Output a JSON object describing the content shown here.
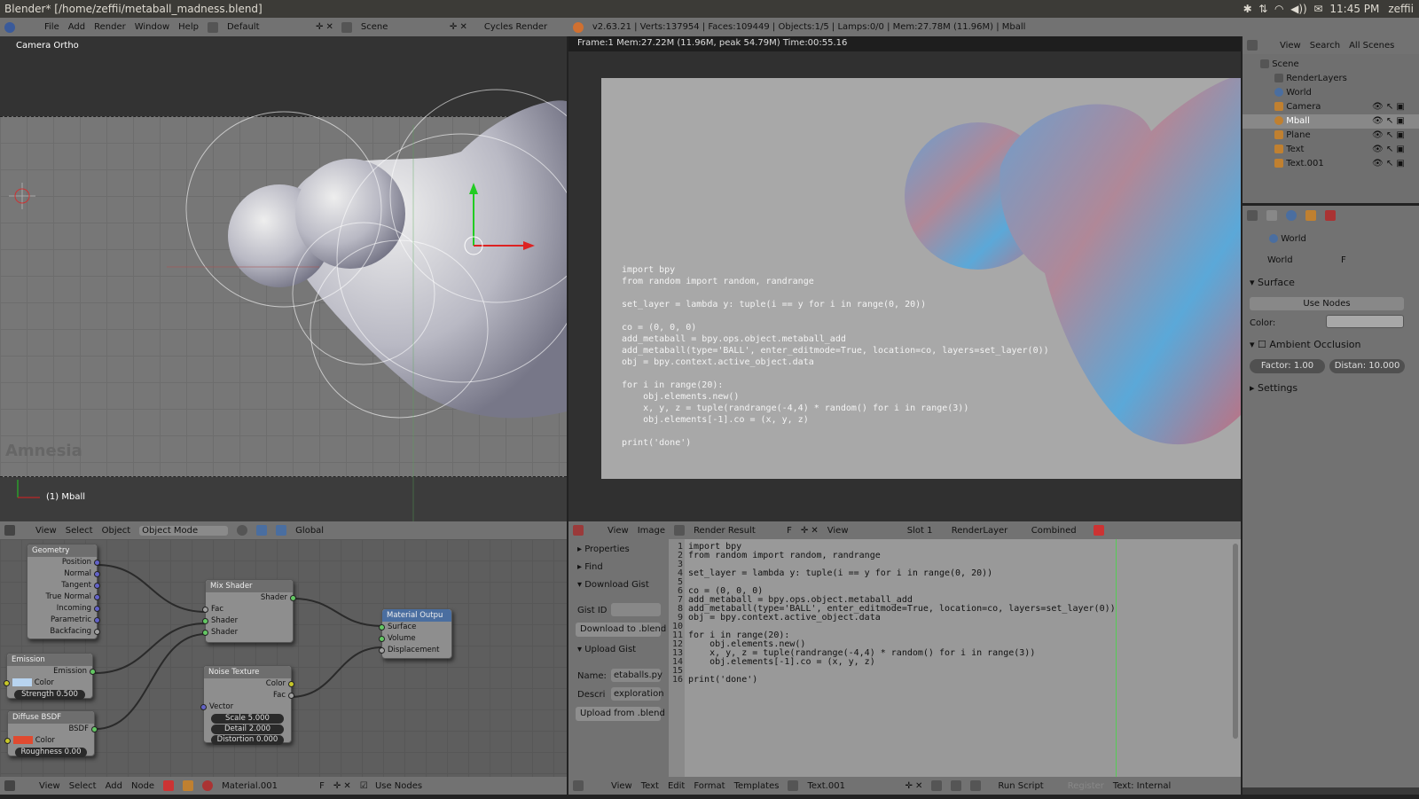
{
  "os": {
    "title": "Blender* [/home/zeffii/metaball_madness.blend]",
    "time": "11:45 PM",
    "user": "zeffii"
  },
  "info": {
    "menu": [
      "File",
      "Add",
      "Render",
      "Window",
      "Help"
    ],
    "layout": "Default",
    "scene": "Scene",
    "engine": "Cycles Render",
    "stats": "v2.63.21 | Verts:137954 | Faces:109449 | Objects:1/5 | Lamps:0/0 | Mem:27.78M (11.96M) | Mball"
  },
  "viewport": {
    "title": "Camera Ortho",
    "object": "(1) Mball",
    "watermark": "Amnesia",
    "header": {
      "view": "View",
      "select": "Select",
      "object": "Object",
      "mode": "Object Mode",
      "orientation": "Global"
    }
  },
  "render": {
    "stats": "Frame:1 Mem:27.22M (11.96M, peak 54.79M) Time:00:55.16",
    "code": [
      "import bpy",
      "from random import random, randrange",
      "",
      "set_layer = lambda y: tuple(i == y for i in range(0, 20))",
      "",
      "co = (0, 0, 0)",
      "add_metaball = bpy.ops.object.metaball_add",
      "add_metaball(type='BALL', enter_editmode=True, location=co, layers=set_layer(0))",
      "obj = bpy.context.active_object.data",
      "",
      "for i in range(20):",
      "    obj.elements.new()",
      "    x, y, z = tuple(randrange(-4,4) * random() for i in range(3))",
      "    obj.elements[-1].co = (x, y, z)",
      "",
      "print('done')"
    ],
    "header": {
      "view": "View",
      "image": "Image",
      "result": "Render Result",
      "f": "F",
      "view2": "View",
      "slot": "Slot 1",
      "layer": "RenderLayer",
      "pass": "Combined"
    }
  },
  "outliner": {
    "header": {
      "view": "View",
      "search": "Search",
      "filter": "All Scenes"
    },
    "items": [
      "Scene",
      "RenderLayers",
      "World",
      "Camera",
      "Mball",
      "Plane",
      "Text",
      "Text.001"
    ]
  },
  "properties": {
    "breadcrumb": "World",
    "world_name": "World",
    "f": "F",
    "surface": "Surface",
    "use_nodes": "Use Nodes",
    "color_label": "Color:",
    "ao": "Ambient Occlusion",
    "factor": "Factor: 1.00",
    "distance": "Distan: 10.000",
    "settings": "Settings"
  },
  "nodes": {
    "geometry": {
      "title": "Geometry",
      "outputs": [
        "Position",
        "Normal",
        "Tangent",
        "True Normal",
        "Incoming",
        "Parametric",
        "Backfacing"
      ]
    },
    "emission": {
      "title": "Emission",
      "out": "Emission",
      "color": "Color",
      "strength": "Strength 0.500"
    },
    "diffuse": {
      "title": "Diffuse BSDF",
      "out": "BSDF",
      "color": "Color",
      "roughness": "Roughness 0.00"
    },
    "mix": {
      "title": "Mix Shader",
      "out": "Shader",
      "fac": "Fac",
      "in1": "Shader",
      "in2": "Shader"
    },
    "noise": {
      "title": "Noise Texture",
      "color": "Color",
      "fac": "Fac",
      "vector": "Vector",
      "scale": "Scale 5.000",
      "detail": "Detail 2.000",
      "distortion": "Distortion 0.000"
    },
    "output": {
      "title": "Material Outpu",
      "surface": "Surface",
      "volume": "Volume",
      "displacement": "Displacement"
    },
    "header": {
      "view": "View",
      "select": "Select",
      "add": "Add",
      "node": "Node",
      "material": "Material.001",
      "f": "F",
      "use_nodes": "Use Nodes"
    }
  },
  "textside": {
    "properties": "Properties",
    "find": "Find",
    "download": "Download Gist",
    "gistid": "Gist ID",
    "download_btn": "Download to .blend",
    "upload": "Upload Gist",
    "name_label": "Name:",
    "name_val": "etaballs.py",
    "desc_label": "Descri",
    "desc_val": "exploration",
    "upload_btn": "Upload from .blend"
  },
  "texteditor": {
    "header": {
      "view": "View",
      "text": "Text",
      "edit": "Edit",
      "format": "Format",
      "templates": "Templates",
      "name": "Text.001",
      "run": "Run Script",
      "register": "Register",
      "type": "Text: Internal"
    }
  }
}
